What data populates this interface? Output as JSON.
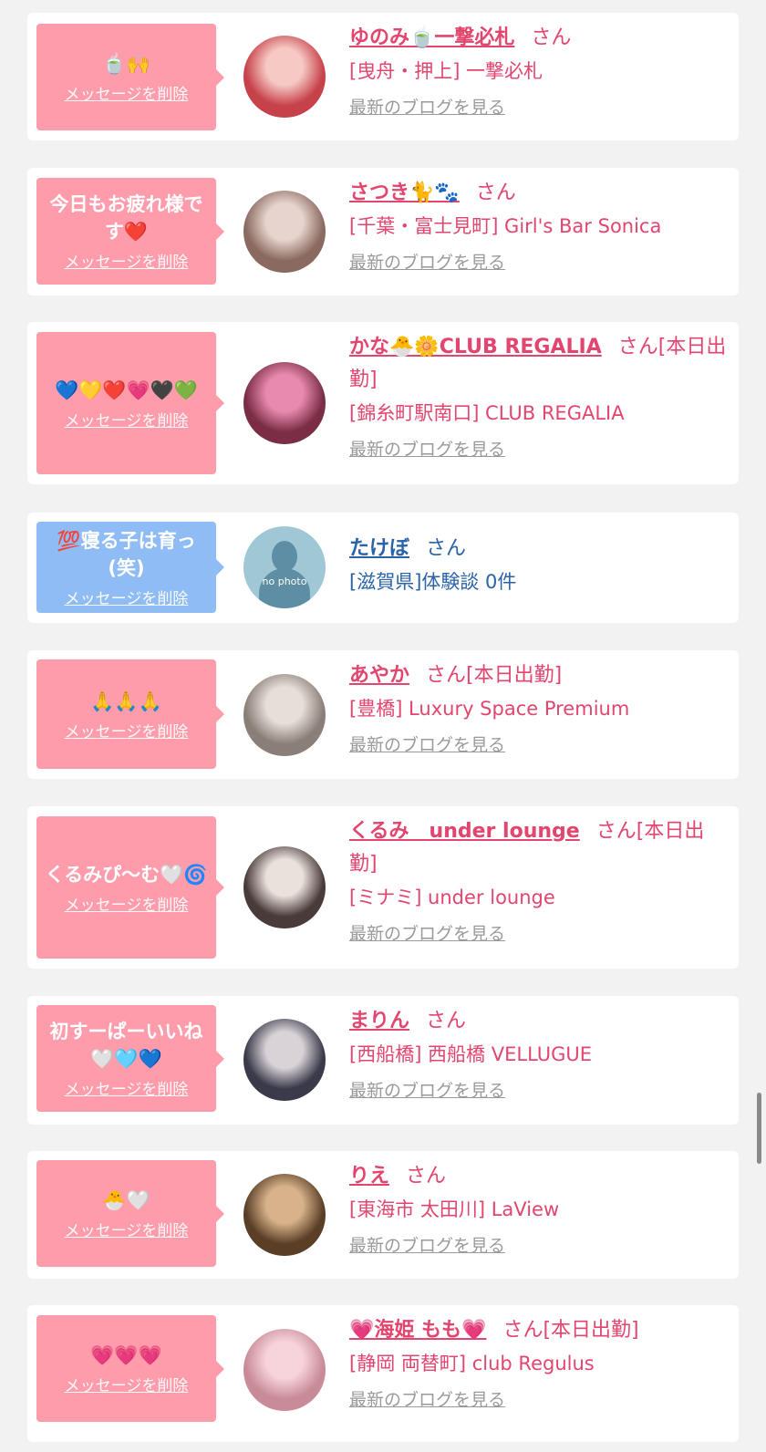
{
  "ui": {
    "delete_label": "メッセージを削除",
    "blog_label": "最新のブログを見る",
    "san_label": "さん"
  },
  "colors": {
    "bubble_pink": "#ff9cab",
    "bubble_blue": "#8fbcf5",
    "name_pink": "#e2456e",
    "name_blue": "#2a63a8",
    "link_gray": "#9a9a9a"
  },
  "cards": [
    {
      "bubble": "pink",
      "message": "🍵🙌",
      "name": "ゆのみ🍵一撃必札",
      "status": "",
      "shop": "[曳舟・押上] 一撃必札",
      "avatar": "photo",
      "show_blog": true
    },
    {
      "bubble": "pink",
      "message": "今日もお疲れ様です❤️",
      "name": "さつき🐈🐾",
      "status": "",
      "shop": "[千葉・富士見町] Girl's Bar Sonica",
      "avatar": "photo",
      "show_blog": true
    },
    {
      "bubble": "pink",
      "message": "💙💛❤️💗🖤💚",
      "name": "かな🐣🌼CLUB REGALIA",
      "status": "[本日出勤]",
      "shop": "[錦糸町駅南口] CLUB REGALIA",
      "avatar": "photo",
      "show_blog": true
    },
    {
      "bubble": "blue",
      "message": "💯寝る子は育っ(笑)",
      "name": "たけぼ",
      "status": "",
      "shop": "[滋賀県]体験談 0件",
      "avatar": "nophoto",
      "nophoto_text": "no photo",
      "show_blog": false
    },
    {
      "bubble": "pink",
      "message": "🙏🙏🙏",
      "name": "あやか",
      "status": "[本日出勤]",
      "shop": "[豊橋] Luxury Space Premium",
      "avatar": "photo",
      "show_blog": true
    },
    {
      "bubble": "pink",
      "message": "くるみぴ〜む🤍🌀",
      "name": "くるみ　under lounge",
      "status": "[本日出勤]",
      "shop": "[ミナミ] under lounge",
      "avatar": "photo",
      "show_blog": true
    },
    {
      "bubble": "pink",
      "message": "初すーぱーいいね🤍🩵💙",
      "name": "まりん",
      "status": "",
      "shop": "[西船橋] 西船橋 VELLUGUE",
      "avatar": "photo",
      "show_blog": true
    },
    {
      "bubble": "pink",
      "message": "🐣🤍",
      "name": "りえ",
      "status": "",
      "shop": "[東海市 太田川] LaView",
      "avatar": "photo",
      "show_blog": true
    },
    {
      "bubble": "pink",
      "message": "💗💗💗",
      "name": "💗海姫 もも💗",
      "status": "[本日出勤]",
      "shop": "[静岡 両替町] club Regulus",
      "avatar": "photo",
      "show_blog": true
    }
  ]
}
